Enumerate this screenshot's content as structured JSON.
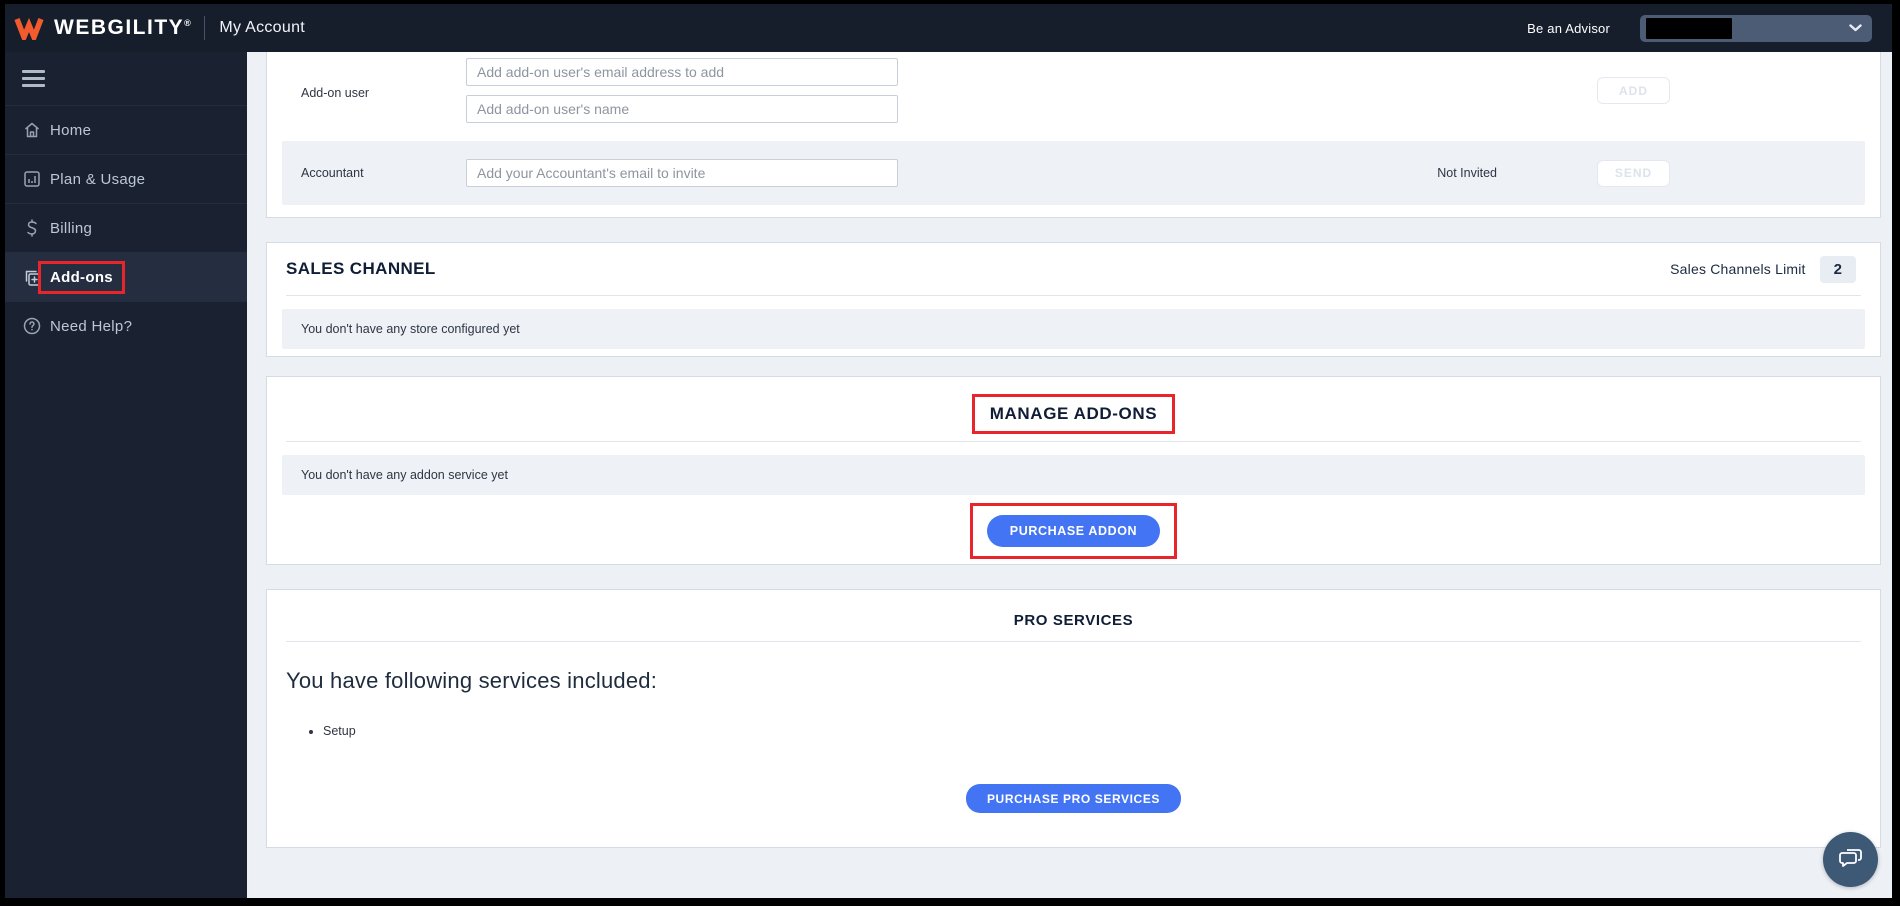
{
  "header": {
    "brand": "WEBGILITY",
    "brand_reg": "®",
    "page_title": "My Account",
    "advisor_link": "Be an Advisor"
  },
  "sidebar": {
    "items": [
      {
        "label": "Home",
        "icon": "home-icon",
        "active": false
      },
      {
        "label": "Plan & Usage",
        "icon": "plan-usage-icon",
        "active": false
      },
      {
        "label": "Billing",
        "icon": "billing-icon",
        "active": false
      },
      {
        "label": "Add-ons",
        "icon": "add-ons-icon",
        "active": true
      },
      {
        "label": "Need Help?",
        "icon": "help-icon",
        "active": false
      }
    ]
  },
  "user_section": {
    "addon_user_label": "Add-on user",
    "email_placeholder": "Add add-on user's email address to add",
    "name_placeholder": "Add add-on user's name",
    "add_button": "ADD",
    "accountant_label": "Accountant",
    "accountant_placeholder": "Add your Accountant's email to invite",
    "accountant_status": "Not Invited",
    "send_button": "SEND"
  },
  "sales_channel": {
    "title": "SALES CHANNEL",
    "limit_label": "Sales Channels Limit",
    "limit_value": "2",
    "empty_message": "You don't have any store configured yet"
  },
  "manage_addons": {
    "title": "MANAGE ADD-ONS",
    "empty_message": "You don't have any addon service yet",
    "purchase_button": "PURCHASE ADDON"
  },
  "pro_services": {
    "title": "PRO SERVICES",
    "included_heading": "You have following services included:",
    "services": [
      "Setup"
    ],
    "purchase_button": "PURCHASE PRO SERVICES"
  },
  "colors": {
    "header_bg": "#161d2b",
    "sidebar_bg": "#1a2231",
    "accent_blue": "#4374f4",
    "annotation_red": "#e8252b",
    "brand_orange": "#f15b2e",
    "content_bg": "#edf0f5",
    "chat_fab_bg": "#3d5976"
  }
}
